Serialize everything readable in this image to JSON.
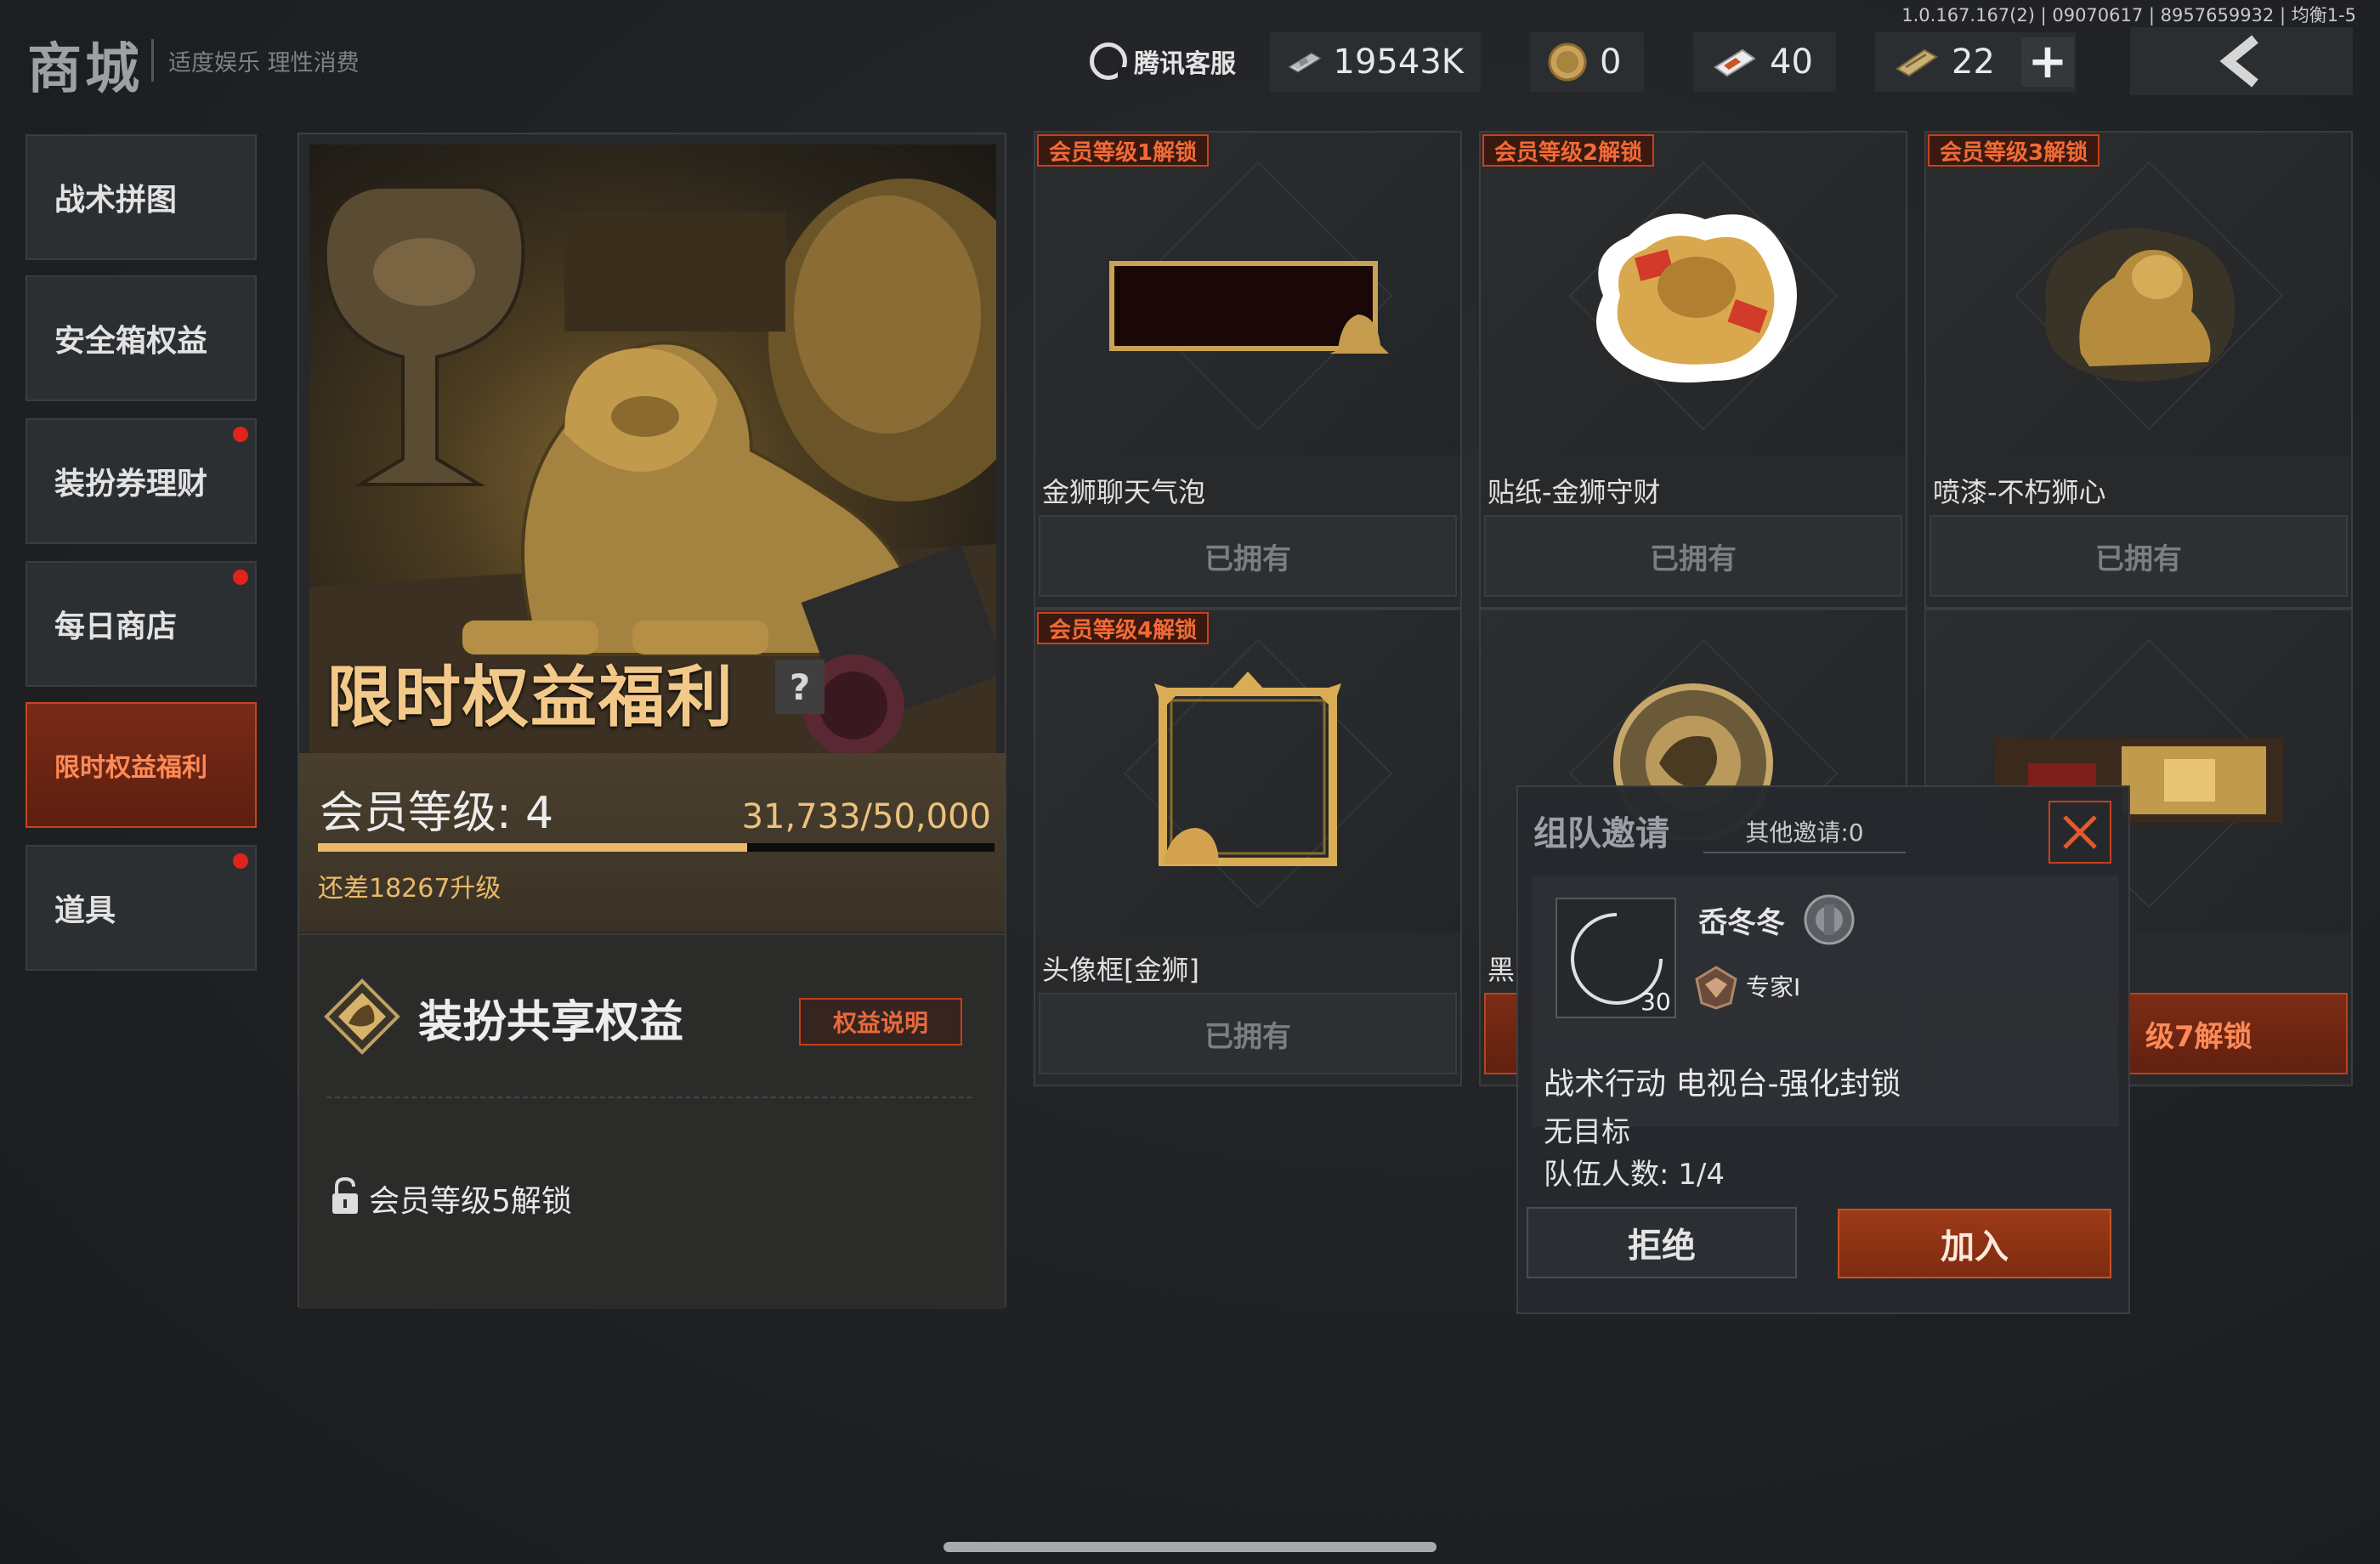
{
  "version": "1.0.167.167(2) | 09070617 | 8957659932 | 均衡1-5",
  "header": {
    "title": "商城",
    "subtitle": "适度娱乐 理性消费",
    "service_label": "腾讯客服",
    "currencies": [
      {
        "icon": "banknote-icon",
        "value": "19543K"
      },
      {
        "icon": "coin-icon",
        "value": "0"
      },
      {
        "icon": "voucher-icon",
        "value": "40"
      },
      {
        "icon": "ticket-icon",
        "value": "22"
      }
    ],
    "plus_symbol": "+"
  },
  "sidebar": {
    "items": [
      {
        "label": "战术拼图",
        "active": false,
        "dot": false
      },
      {
        "label": "安全箱权益",
        "active": false,
        "dot": false
      },
      {
        "label": "装扮券理财",
        "active": false,
        "dot": true
      },
      {
        "label": "每日商店",
        "active": false,
        "dot": true
      },
      {
        "label": "限时权益福利",
        "active": true,
        "dot": false
      },
      {
        "label": "道具",
        "active": false,
        "dot": true
      }
    ]
  },
  "hero": {
    "title": "限时权益福利",
    "help": "?",
    "vip_label": "会员等级: 4",
    "vip_progress": "31,733/50,000",
    "vip_progress_fraction": 0.6347,
    "vip_remain": "还差18267升级",
    "share_title": "装扮共享权益",
    "rule_button": "权益说明",
    "lock_text": "会员等级5解锁"
  },
  "cards": [
    {
      "badge": "会员等级1解锁",
      "name": "金狮聊天气泡",
      "button": "已拥有",
      "state": "owned"
    },
    {
      "badge": "会员等级2解锁",
      "name": "贴纸-金狮守财",
      "button": "已拥有",
      "state": "owned"
    },
    {
      "badge": "会员等级3解锁",
      "name": "喷漆-不朽狮心",
      "button": "已拥有",
      "state": "owned"
    },
    {
      "badge": "会员等级4解锁",
      "name": "头像框[金狮]",
      "button": "已拥有",
      "state": "owned"
    },
    {
      "badge": "",
      "name": "黑",
      "button": "",
      "state": "locked"
    },
    {
      "badge": "",
      "name": "",
      "button": "级7解锁",
      "state": "locked"
    }
  ],
  "popup": {
    "title": "组队邀请",
    "other_invites": "其他邀请:0",
    "player_name": "岙冬冬",
    "player_level": "30",
    "player_rank": "专家I",
    "mode": "战术行动 电视台-强化封锁",
    "target": "无目标",
    "team_count": "队伍人数: 1/4",
    "reject": "拒绝",
    "join": "加入"
  },
  "colors": {
    "accent": "#c5421c",
    "gold": "#e9b969",
    "background": "#1e2023"
  }
}
